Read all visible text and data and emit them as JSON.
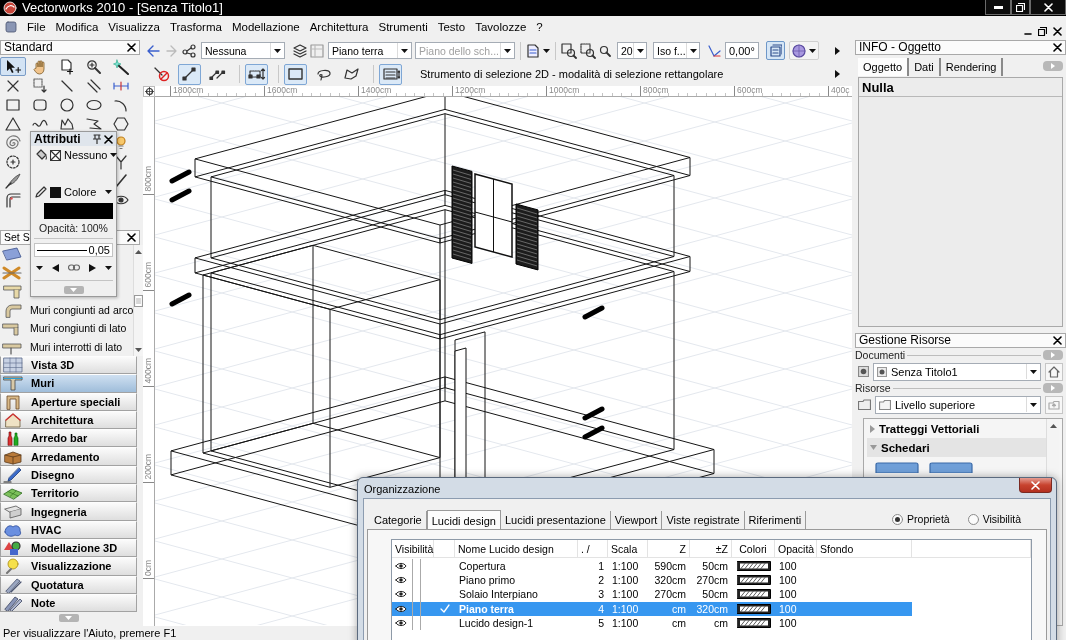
{
  "window": {
    "title": "Vectorworks 2010 - [Senza Titolo1]"
  },
  "menu": [
    "File",
    "Modifica",
    "Visualizza",
    "Trasforma",
    "Modellazione",
    "Architettura",
    "Strumenti",
    "Testo",
    "Tavolozze",
    "?"
  ],
  "view_bar": {
    "class": "Nessuna",
    "layer": "Piano terra",
    "sheet_layer": {
      "value": "Piano dello sch...",
      "disabled": true
    },
    "zoom": "20",
    "view": "Iso f...",
    "angle": "0,00°",
    "toggles": [
      {
        "selected": true
      },
      {
        "selected": false
      }
    ]
  },
  "mode_bar": {
    "modes": [
      {
        "selected": false
      },
      {
        "selected": true
      },
      {
        "selected": false
      },
      {
        "selected": true
      },
      {
        "selected": true
      },
      {
        "selected": false
      },
      {
        "selected": false
      },
      {
        "selected": true
      }
    ],
    "help": "Strumento di selezione 2D - modalità di selezione rettangolare"
  },
  "rulers": {
    "horizontal": [
      "1800cm",
      "1600cm",
      "1400cm",
      "1200cm",
      "1000cm",
      "800cm",
      "600cm",
      "400c"
    ],
    "vertical": [
      "800cm",
      "600cm",
      "400cm",
      "200cm",
      "0cm"
    ]
  },
  "standard_palette": {
    "title": "Standard",
    "tools": [
      {
        "selected": true
      },
      {
        "selected": false
      },
      {
        "selected": false
      },
      {
        "selected": false
      },
      {
        "selected": false
      },
      {
        "selected": false
      },
      {
        "selected": false
      },
      {
        "selected": false
      },
      {
        "selected": false
      },
      {
        "selected": false
      },
      {
        "selected": false
      },
      {
        "selected": false
      },
      {
        "selected": false
      },
      {
        "selected": false
      },
      {
        "selected": false
      },
      {
        "selected": false
      },
      {
        "selected": false
      },
      {
        "selected": false
      },
      {
        "selected": false
      },
      {
        "selected": false
      },
      {
        "selected": false
      },
      {
        "selected": false
      },
      {
        "selected": false
      },
      {
        "selected": false
      },
      {
        "selected": false
      },
      {
        "selected": false
      },
      {
        "selected": false
      },
      {
        "selected": false
      }
    ]
  },
  "attributes_palette": {
    "title": "Attributi",
    "fill": "Nessuno",
    "pen": "Colore",
    "opacity": "Opacità: 100%",
    "line_thickness": "0,05"
  },
  "tool_set_palette": {
    "title": "Set S",
    "tools": [
      "Muri congiunti ad arco",
      "Muri congiunti di lato",
      "Muri interrotti di lato"
    ]
  },
  "tool_sets": [
    {
      "label": "Vista 3D",
      "selected": false
    },
    {
      "label": "Muri",
      "selected": true
    },
    {
      "label": "Aperture speciali",
      "selected": false
    },
    {
      "label": "Architettura",
      "selected": false
    },
    {
      "label": "Arredo bar",
      "selected": false
    },
    {
      "label": "Arredamento",
      "selected": false
    },
    {
      "label": "Disegno",
      "selected": false
    },
    {
      "label": "Territorio",
      "selected": false
    },
    {
      "label": "Ingegneria",
      "selected": false
    },
    {
      "label": "HVAC",
      "selected": false
    },
    {
      "label": "Modellazione 3D",
      "selected": false
    },
    {
      "label": "Visualizzazione",
      "selected": false
    },
    {
      "label": "Quotatura",
      "selected": false
    },
    {
      "label": "Note",
      "selected": false
    }
  ],
  "info_palette": {
    "title": "INFO - Oggetto",
    "tabs": [
      {
        "label": "Oggetto",
        "selected": true
      },
      {
        "label": "Dati",
        "selected": false
      },
      {
        "label": "Rendering",
        "selected": false
      }
    ],
    "object": "Nulla"
  },
  "resource_browser": {
    "title": "Gestione Risorse",
    "documents_label": "Documenti",
    "document": "Senza Titolo1",
    "resources_label": "Risorse",
    "folder": "Livello superiore",
    "groups": [
      {
        "label": "Tratteggi Vettoriali",
        "expanded": false
      },
      {
        "label": "Schedari",
        "expanded": true
      }
    ]
  },
  "dialog": {
    "title": "Organizzazione",
    "tabs": [
      {
        "label": "Categorie",
        "selected": false
      },
      {
        "label": "Lucidi design",
        "selected": true
      },
      {
        "label": "Lucidi presentazione",
        "selected": false
      },
      {
        "label": "Viewport",
        "selected": false
      },
      {
        "label": "Viste registrate",
        "selected": false
      },
      {
        "label": "Riferimenti",
        "selected": false
      }
    ],
    "options": [
      {
        "label": "Proprietà",
        "selected": true
      },
      {
        "label": "Visibilità",
        "selected": false
      }
    ],
    "table": {
      "columns": [
        "Visibilità",
        "Nome Lucido design",
        ". /",
        "Scala",
        "Z",
        "±Z",
        "Colori",
        "Opacità",
        "Sfondo"
      ],
      "rows": [
        {
          "visible": true,
          "active": false,
          "selected": false,
          "name": "Copertura",
          "order": "1",
          "scale": "1:100",
          "z": "590cm",
          "dz": "50cm",
          "opacity": "100"
        },
        {
          "visible": true,
          "active": false,
          "selected": false,
          "name": "Piano primo",
          "order": "2",
          "scale": "1:100",
          "z": "320cm",
          "dz": "270cm",
          "opacity": "100"
        },
        {
          "visible": true,
          "active": false,
          "selected": false,
          "name": "Solaio Interpiano",
          "order": "3",
          "scale": "1:100",
          "z": "270cm",
          "dz": "50cm",
          "opacity": "100"
        },
        {
          "visible": true,
          "active": true,
          "selected": true,
          "name": "Piano terra",
          "order": "4",
          "scale": "1:100",
          "z": "cm",
          "dz": "320cm",
          "opacity": "100"
        },
        {
          "visible": true,
          "active": false,
          "selected": false,
          "name": "Lucido design-1",
          "order": "5",
          "scale": "1:100",
          "z": "cm",
          "dz": "cm",
          "opacity": "100"
        }
      ]
    }
  },
  "status_bar": "Per visualizzare l'Aiuto, premere F1"
}
